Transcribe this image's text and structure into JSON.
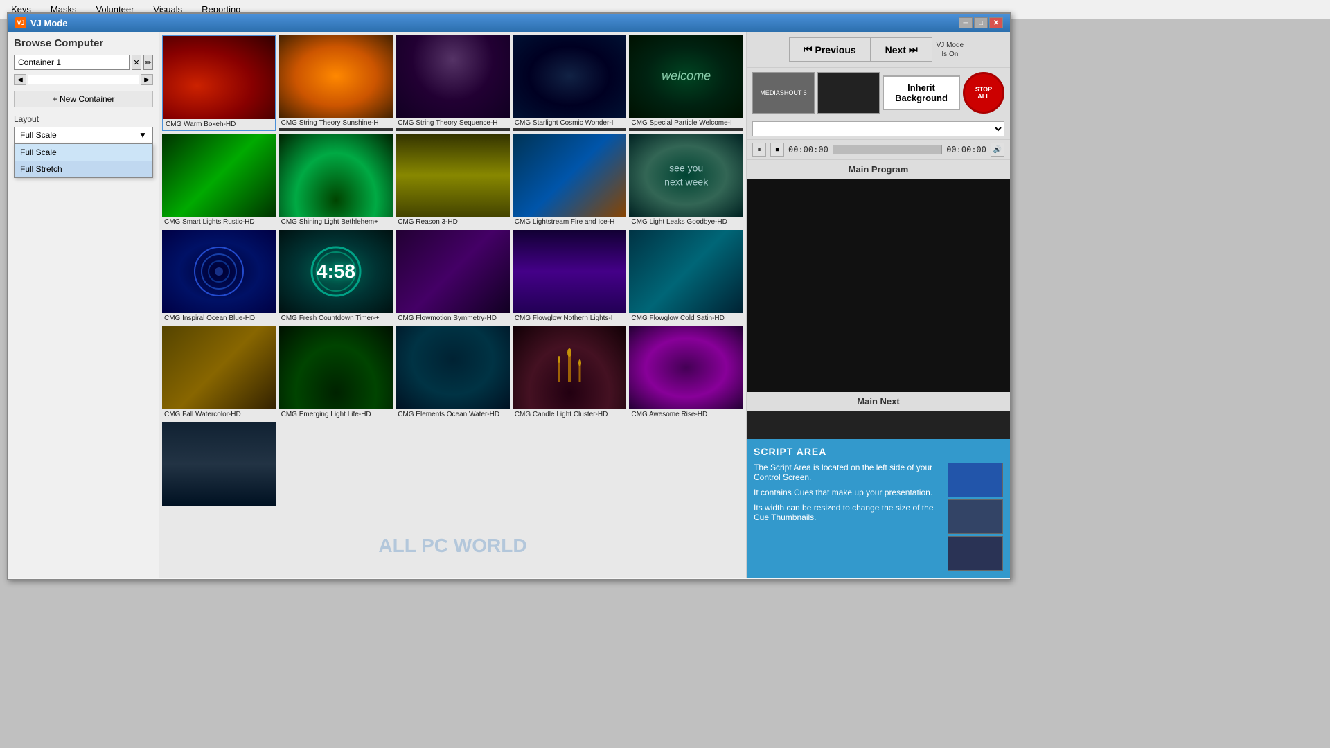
{
  "topmenu": {
    "items": [
      "Keys",
      "Masks",
      "Volunteer",
      "Visuals",
      "Reporting"
    ]
  },
  "window": {
    "title": "VJ Mode",
    "icon": "VJ"
  },
  "leftpanel": {
    "browse_title": "Browse Computer",
    "container_value": "Container 1",
    "new_container_label": "+ New Container",
    "layout_label": "Layout",
    "layout_selected": "Full Scale",
    "layout_options": [
      "Full Scale",
      "Full Stretch"
    ]
  },
  "media_items": [
    {
      "id": 1,
      "label": "CMG Warm Bokeh-HD",
      "thumb_class": "thumb-warm-bokeh",
      "selected": true
    },
    {
      "id": 2,
      "label": "CMG String Theory Sunshine-H",
      "thumb_class": "thumb-string-sunshine"
    },
    {
      "id": 3,
      "label": "CMG String Theory Sequence-H",
      "thumb_class": "thumb-string-sequence"
    },
    {
      "id": 4,
      "label": "CMG Starlight Cosmic Wonder-I",
      "thumb_class": "thumb-starlight"
    },
    {
      "id": 5,
      "label": "CMG Special Particle Welcome-I",
      "thumb_class": "thumb-special-particle",
      "overlay": "welcome"
    },
    {
      "id": 6,
      "label": "CMG Smart Lights Rustic-HD",
      "thumb_class": "thumb-smart-lights"
    },
    {
      "id": 7,
      "label": "CMG Shining Light Bethlehem+",
      "thumb_class": "thumb-shining-light"
    },
    {
      "id": 8,
      "label": "CMG Reason 3-HD",
      "thumb_class": "thumb-reason"
    },
    {
      "id": 9,
      "label": "CMG Lightstream Fire and Ice-H",
      "thumb_class": "thumb-lightstream"
    },
    {
      "id": 10,
      "label": "CMG Light Leaks Goodbye-HD",
      "thumb_class": "thumb-light-leaks",
      "overlay": "seeyou"
    },
    {
      "id": 11,
      "label": "CMG Inspiral Ocean Blue-HD",
      "thumb_class": "thumb-inspiral"
    },
    {
      "id": 12,
      "label": "CMG Fresh Countdown Timer-+",
      "thumb_class": "thumb-countdown",
      "overlay": "countdown"
    },
    {
      "id": 13,
      "label": "CMG Flowmotion Symmetry-HD",
      "thumb_class": "thumb-flowmotion"
    },
    {
      "id": 14,
      "label": "CMG Flowglow Nothern Lights-I",
      "thumb_class": "thumb-flowglow-nothern"
    },
    {
      "id": 15,
      "label": "CMG Flowglow Cold Satin-HD",
      "thumb_class": "thumb-flowglow-cold"
    },
    {
      "id": 16,
      "label": "CMG Fall Watercolor-HD",
      "thumb_class": "thumb-fall-watercolor"
    },
    {
      "id": 17,
      "label": "CMG Emerging Light Life-HD",
      "thumb_class": "thumb-emerging-light"
    },
    {
      "id": 18,
      "label": "CMG Elements Ocean Water-HD",
      "thumb_class": "thumb-elements-ocean"
    },
    {
      "id": 19,
      "label": "CMG Candle Light Cluster-HD",
      "thumb_class": "thumb-candle-light"
    },
    {
      "id": 20,
      "label": "CMG Awesome Rise-HD",
      "thumb_class": "thumb-awesome-rise"
    },
    {
      "id": 21,
      "label": "",
      "thumb_class": "thumb-last"
    }
  ],
  "rightpanel": {
    "previous_label": "Previous",
    "next_label": "Next",
    "vj_mode_label": "VJ Mode\nIs On",
    "inherit_bg_label": "Inherit\nBackground",
    "stop_all_line1": "STOP",
    "stop_all_line2": "ALL",
    "timecode_start": "00:00:00",
    "timecode_end": "00:00:00",
    "main_program_label": "Main Program",
    "main_next_label": "Main Next",
    "mediashout_label": "MEDIASHOUT 6"
  },
  "script": {
    "title": "SCRIPT AREA",
    "line1": "The Script Area is located on the left side of your Control Screen.",
    "line2": "It contains Cues that make up your presentation.",
    "line3": "Its width can be resized to change the size of the Cue Thumbnails."
  },
  "watermark": "ALL PC WORLD"
}
